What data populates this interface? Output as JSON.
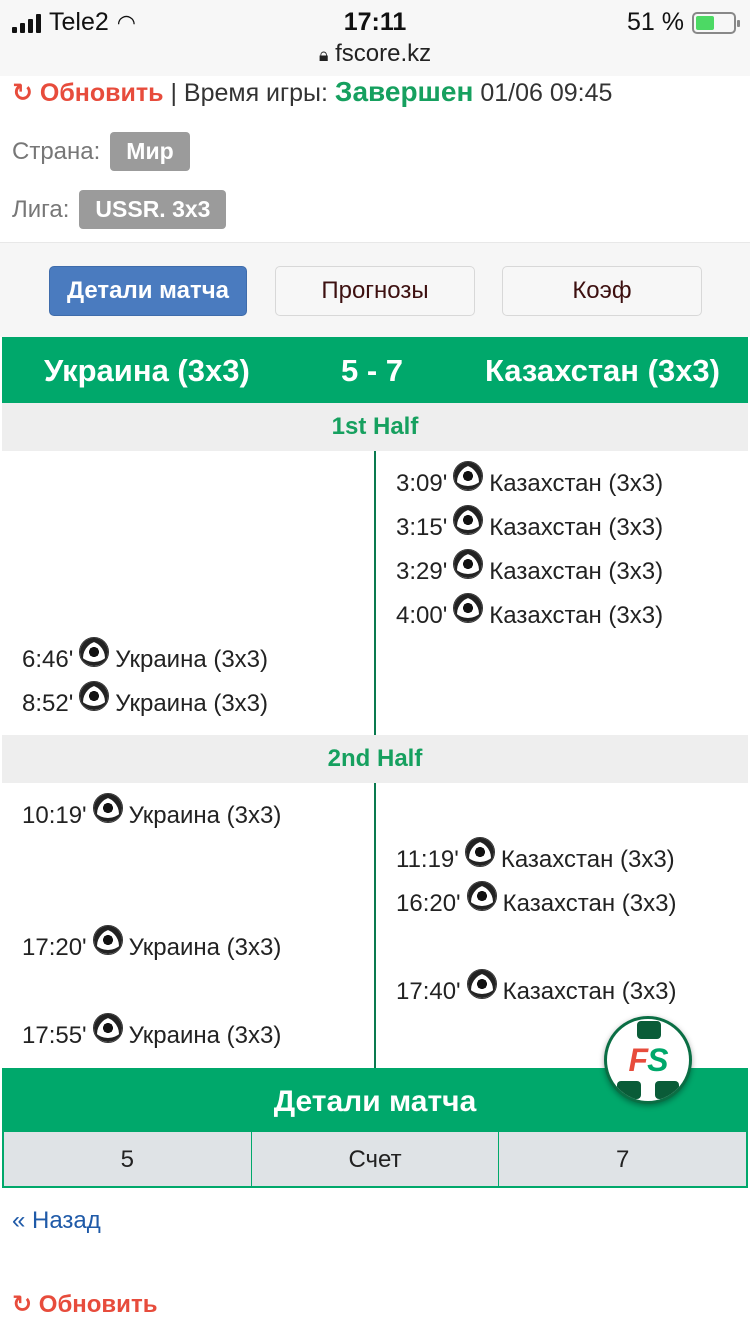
{
  "statusbar": {
    "carrier": "Tele2",
    "time": "17:11",
    "url": "fscore.kz",
    "battery": "51 %"
  },
  "info": {
    "refresh_label": "Обновить",
    "separator": " | ",
    "game_time_label": "Время игры: ",
    "status": "Завершен",
    "datetime": " 01/06 09:45",
    "country_label": "Страна:",
    "country": "Мир",
    "league_label": "Лига:",
    "league": "USSR. 3x3"
  },
  "tabs": [
    {
      "label": "Детали матча",
      "active": true
    },
    {
      "label": "Прогнозы",
      "active": false
    },
    {
      "label": "Коэф",
      "active": false
    }
  ],
  "match": {
    "home": "Украина (3x3)",
    "score": "5 - 7",
    "away": "Казахстан (3x3)"
  },
  "halves": [
    {
      "title": "1st Half",
      "events": [
        {
          "side": "away",
          "minute": "3:09'",
          "team": "Казахстан (3x3)"
        },
        {
          "side": "away",
          "minute": "3:15'",
          "team": "Казахстан (3x3)"
        },
        {
          "side": "away",
          "minute": "3:29'",
          "team": "Казахстан (3x3)"
        },
        {
          "side": "away",
          "minute": "4:00'",
          "team": "Казахстан (3x3)"
        },
        {
          "side": "home",
          "minute": "6:46'",
          "team": "Украина (3x3)"
        },
        {
          "side": "home",
          "minute": "8:52'",
          "team": "Украина (3x3)"
        }
      ]
    },
    {
      "title": "2nd Half",
      "events": [
        {
          "side": "home",
          "minute": "10:19'",
          "team": "Украина (3x3)"
        },
        {
          "side": "away",
          "minute": "11:19'",
          "team": "Казахстан (3x3)"
        },
        {
          "side": "away",
          "minute": "16:20'",
          "team": "Казахстан (3x3)"
        },
        {
          "side": "home",
          "minute": "17:20'",
          "team": "Украина (3x3)"
        },
        {
          "side": "away",
          "minute": "17:40'",
          "team": "Казахстан (3x3)"
        },
        {
          "side": "home",
          "minute": "17:55'",
          "team": "Украина (3x3)"
        }
      ]
    }
  ],
  "details": {
    "title": "Детали матча",
    "home_score": "5",
    "label": "Счет",
    "away_score": "7"
  },
  "footer": {
    "back": "« Назад",
    "refresh": "Обновить"
  },
  "logo": {
    "f": "F",
    "s": "S"
  },
  "colors": {
    "brand_green": "#00a86b",
    "refresh_red": "#e74c3c",
    "active_tab": "#4a7bbf"
  }
}
